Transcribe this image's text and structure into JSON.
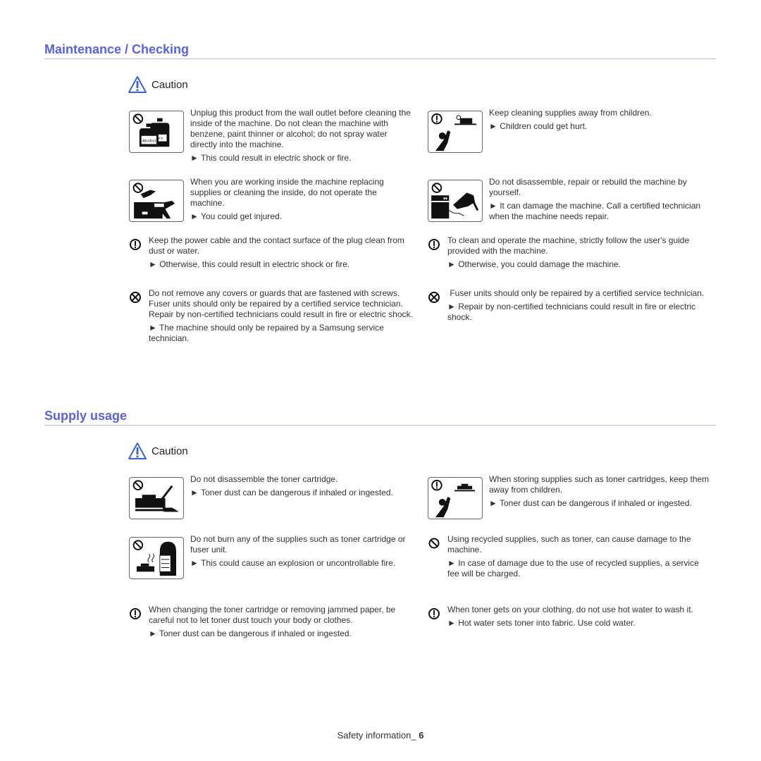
{
  "sections": {
    "maintenance": {
      "title": "Maintenance / Checking",
      "caution": "Caution",
      "items": [
        {
          "text": "Unplug this product from the wall outlet before cleaning the inside of the machine. Do not clean the machine with benzene, paint thinner or alcohol; do not spray water directly into the machine.",
          "note": "► This could result in electric shock or fire.",
          "icon": "no-alcohol-cleaning-icon",
          "bottle_label": "Alcohol"
        },
        {
          "text": "Keep cleaning supplies away from children.",
          "note": "► Children could get hurt.",
          "icon": "keep-away-from-children-icon"
        },
        {
          "text": "When you are working inside the machine replacing supplies or cleaning the inside, do not operate the machine.",
          "note": "► You could get injured.",
          "icon": "hand-in-machine-icon"
        },
        {
          "text": "Do not disassemble, repair or rebuild the machine by yourself.",
          "note": "► It can damage the machine. Call a certified technician when the machine needs repair.",
          "icon": "no-drill-repair-icon"
        },
        {
          "text": "Keep the power cable and the contact surface of the plug clean from dust or water.",
          "note": "► Otherwise, this could result in electric shock or fire.",
          "icon": "mandatory-icon"
        },
        {
          "text": "To clean and operate the machine, strictly follow the user's guide provided with the machine.",
          "note": "► Otherwise, you could damage the machine.",
          "icon": "mandatory-icon"
        },
        {
          "text": "Do not remove any covers or guards that are fastened with screws.",
          "text2": "Fuser units should only be repaired by a certified service technician. Repair by non-certified technicians could result in fire or electric shock.",
          "note": "► The machine should only be repaired by a Samsung service technician.",
          "icon": "no-disassemble-icon"
        },
        {
          "text": " Fuser units should only be repaired by a certified service technician.",
          "note": "► Repair by non-certified technicians could result in fire or electric shock.",
          "icon": "no-disassemble-icon"
        }
      ]
    },
    "supply": {
      "title": "Supply usage",
      "caution": "Caution",
      "items": [
        {
          "text": "Do not disassemble the toner cartridge.",
          "note": "► Toner dust can be dangerous if inhaled or ingested.",
          "icon": "no-disassemble-toner-icon"
        },
        {
          "text": "When storing supplies such as toner cartridges, keep them away from children.",
          "note": "► Toner dust can be dangerous if inhaled or ingested.",
          "icon": "keep-toner-from-children-icon"
        },
        {
          "text": "Do not burn any of the supplies such as toner cartridge or fuser unit.",
          "note": "► This could cause an explosion or uncontrollable fire.",
          "icon": "no-burn-icon"
        },
        {
          "text": "Using recycled supplies, such as toner, can cause damage to the machine.",
          "note": "► In case of damage due to the use of recycled supplies, a service fee will be charged.",
          "icon": "prohibited-icon"
        },
        {
          "text": "When changing the toner cartridge or removing jammed paper, be careful not to let toner dust touch your body or clothes.",
          "note": "► Toner dust can be dangerous if inhaled or ingested.",
          "icon": "mandatory-icon"
        },
        {
          "text": "When toner gets on your clothing, do not use hot water to wash it.",
          "note": "► Hot water sets toner into fabric. Use cold water.",
          "icon": "mandatory-icon"
        }
      ]
    }
  },
  "footer": {
    "label": "Safety information_",
    "page": "6"
  },
  "colors": {
    "heading": "#5a62e0",
    "rule": "#b7b9ee",
    "caution_icon": "#3a63d6"
  }
}
